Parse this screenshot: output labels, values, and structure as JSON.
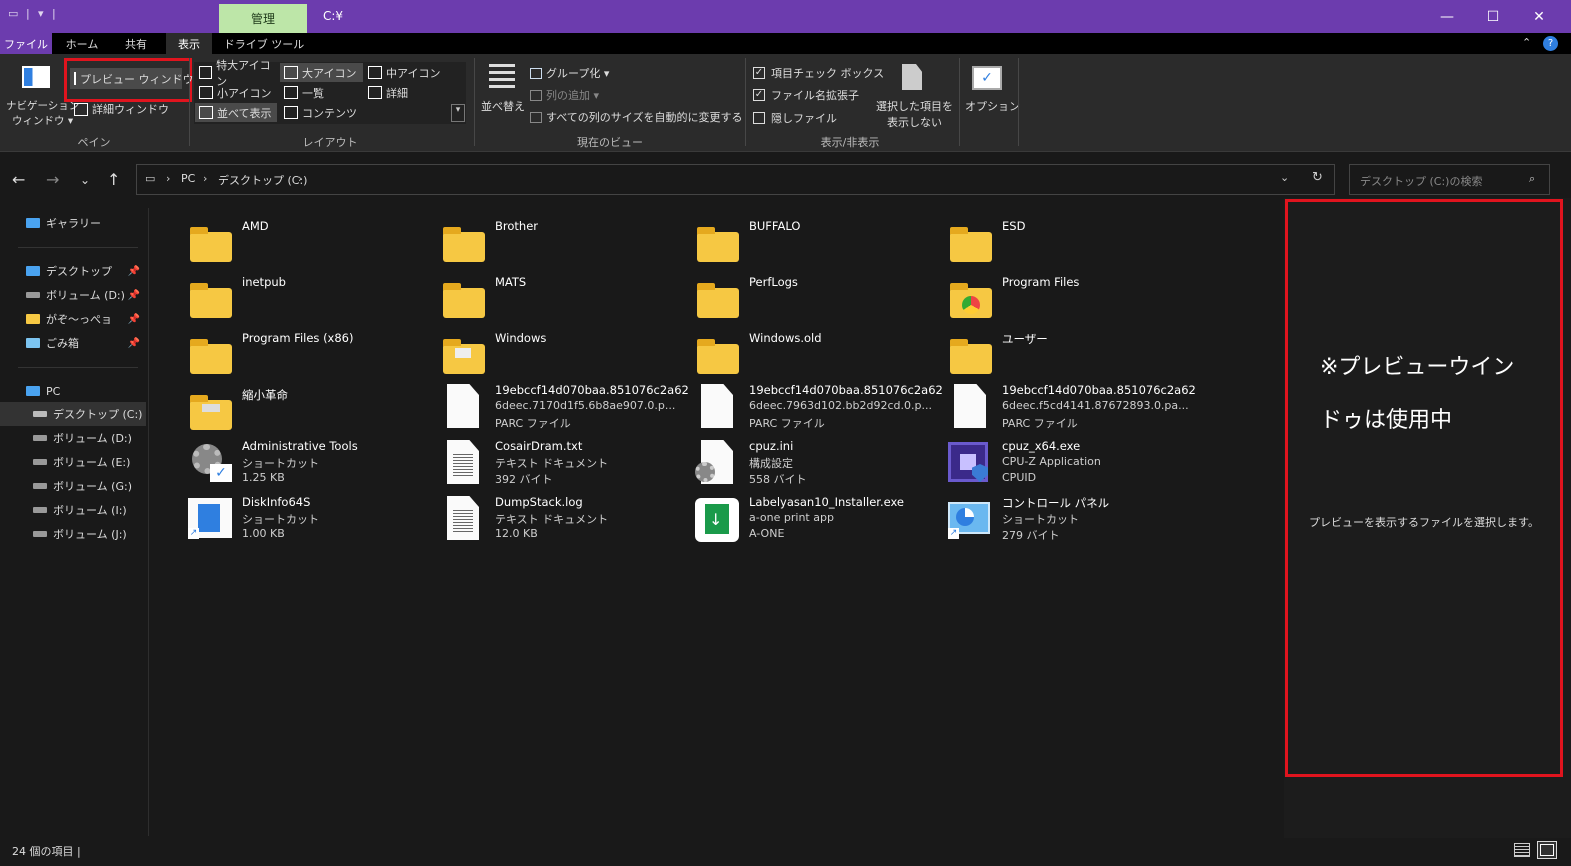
{
  "titlebar": {
    "context_tab": "管理",
    "path": "C:¥",
    "minimize": "—",
    "maximize": "☐",
    "close": "✕"
  },
  "tabs": [
    "ファイル",
    "ホーム",
    "共有",
    "表示",
    "ドライブ ツール"
  ],
  "ribbon": {
    "pane": {
      "nav_pane": "ナビゲーション",
      "nav_pane2": "ウィンドウ ▾",
      "preview_pane": "プレビュー ウィンドウ",
      "details_pane": "詳細ウィンドウ",
      "label": "ペイン"
    },
    "layout": {
      "items": [
        "特大アイコン",
        "大アイコン",
        "中アイコン",
        "小アイコン",
        "一覧",
        "詳細",
        "並べて表示",
        "コンテンツ"
      ],
      "label": "レイアウト"
    },
    "current_view": {
      "sort": "並べ替え",
      "group": "グループ化 ▾",
      "add_columns": "列の追加 ▾",
      "fit_columns": "すべての列のサイズを自動的に変更する",
      "label": "現在のビュー"
    },
    "show_hide": {
      "item_checkbox": "項目チェック ボックス",
      "extensions": "ファイル名拡張子",
      "hidden": "隠しファイル",
      "hide_selected_1": "選択した項目を",
      "hide_selected_2": "表示しない",
      "label": "表示/非表示"
    },
    "options": "オプション"
  },
  "address": {
    "pc": "PC",
    "drive": "デスクトップ (C:)",
    "search_placeholder": "デスクトップ (C:)の検索"
  },
  "sidebar": {
    "gallery": "ギャラリー",
    "pinned": [
      "デスクトップ",
      "ボリューム (D:)",
      "がぞ～っぺョ",
      "ごみ箱"
    ],
    "pc": "PC",
    "drives": [
      "デスクトップ (C:)",
      "ボリューム (D:)",
      "ボリューム (E:)",
      "ボリューム (G:)",
      "ボリューム (I:)",
      "ボリューム (J:)"
    ]
  },
  "files": [
    {
      "name": "AMD",
      "l2": "",
      "l3": "",
      "type": "folder"
    },
    {
      "name": "Brother",
      "l2": "",
      "l3": "",
      "type": "folder"
    },
    {
      "name": "BUFFALO",
      "l2": "",
      "l3": "",
      "type": "folder"
    },
    {
      "name": "ESD",
      "l2": "",
      "l3": "",
      "type": "folder"
    },
    {
      "name": "inetpub",
      "l2": "",
      "l3": "",
      "type": "folder"
    },
    {
      "name": "MATS",
      "l2": "",
      "l3": "",
      "type": "folder"
    },
    {
      "name": "PerfLogs",
      "l2": "",
      "l3": "",
      "type": "folder"
    },
    {
      "name": "Program Files",
      "l2": "",
      "l3": "",
      "type": "folder"
    },
    {
      "name": "Program Files (x86)",
      "l2": "",
      "l3": "",
      "type": "folder"
    },
    {
      "name": "Windows",
      "l2": "",
      "l3": "",
      "type": "folder"
    },
    {
      "name": "Windows.old",
      "l2": "",
      "l3": "",
      "type": "folder"
    },
    {
      "name": "ユーザー",
      "l2": "",
      "l3": "",
      "type": "folder"
    },
    {
      "name": "縮小革命",
      "l2": "",
      "l3": "",
      "type": "folder"
    },
    {
      "name": "19ebccf14d070baa.851076c2a62",
      "l2": "6deec.7170d1f5.6b8ae907.0.p...",
      "l3": "PARC ファイル",
      "type": "doc"
    },
    {
      "name": "19ebccf14d070baa.851076c2a62",
      "l2": "6deec.7963d102.bb2d92cd.0.p...",
      "l3": "PARC ファイル",
      "type": "doc"
    },
    {
      "name": "19ebccf14d070baa.851076c2a62",
      "l2": "6deec.f5cd4141.87672893.0.pa...",
      "l3": "PARC ファイル",
      "type": "doc"
    },
    {
      "name": "Administrative Tools",
      "l2": "ショートカット",
      "l3": "1.25 KB",
      "type": "admin"
    },
    {
      "name": "CosairDram.txt",
      "l2": "テキスト ドキュメント",
      "l3": "392 バイト",
      "type": "txt"
    },
    {
      "name": "cpuz.ini",
      "l2": "構成設定",
      "l3": "558 バイト",
      "type": "ini"
    },
    {
      "name": "cpuz_x64.exe",
      "l2": "CPU-Z Application",
      "l3": "CPUID",
      "type": "cpuz"
    },
    {
      "name": "DiskInfo64S",
      "l2": "ショートカット",
      "l3": "1.00 KB",
      "type": "disk"
    },
    {
      "name": "DumpStack.log",
      "l2": "テキスト ドキュメント",
      "l3": "12.0 KB",
      "type": "txt"
    },
    {
      "name": "Labelyasan10_Installer.exe",
      "l2": "a-one print app",
      "l3": "A-ONE",
      "type": "label"
    },
    {
      "name": "コントロール パネル",
      "l2": "ショートカット",
      "l3": "279 バイト",
      "type": "cpanel"
    }
  ],
  "preview": {
    "title": "※プレビューウインドゥは使用中",
    "message": "プレビューを表示するファイルを選択します。"
  },
  "status": "24 個の項目  |",
  "colors": {
    "accent": "#6c3cae",
    "context": "#bde6a8",
    "highlight": "#e0141e",
    "folder": "#f6c843"
  }
}
